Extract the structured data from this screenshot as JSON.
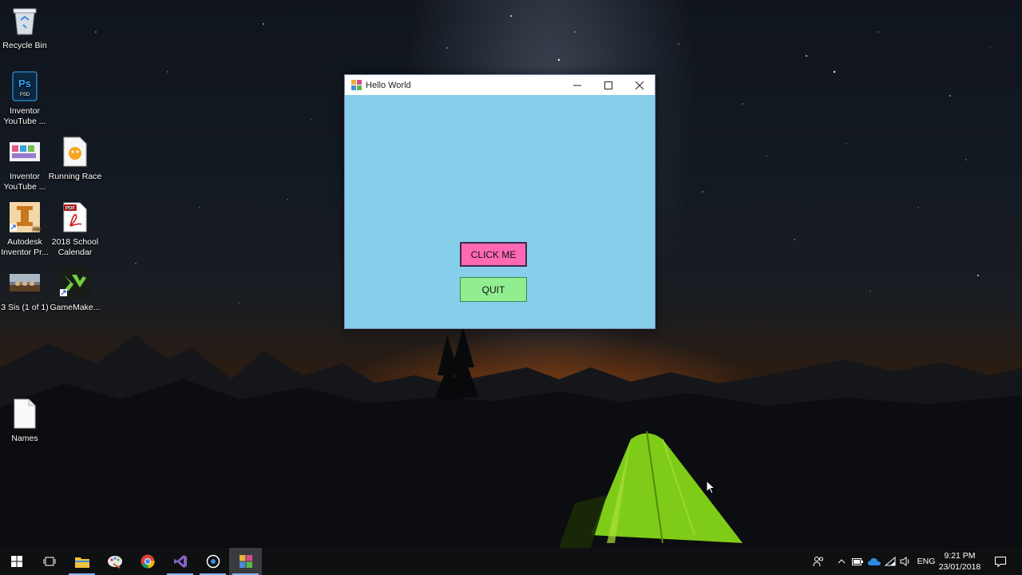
{
  "desktop": {
    "icons": [
      {
        "name": "recycle-bin",
        "label": "Recycle Bin",
        "icon": "recycle-bin-icon"
      },
      {
        "name": "psd-file",
        "label": "Inventor\nYouTube ...",
        "icon": "photoshop-icon"
      },
      {
        "name": "image-file",
        "label": "Inventor\nYouTube ...",
        "icon": "image-thumbnail-icon"
      },
      {
        "name": "scratch-file",
        "label": "Running Race",
        "icon": "scratch-cat-icon"
      },
      {
        "name": "autodesk-inventor",
        "label": "Autodesk\nInventor Pr...",
        "icon": "autodesk-inventor-icon"
      },
      {
        "name": "school-calendar",
        "label": "2018 School\nCalendar",
        "icon": "pdf-icon"
      },
      {
        "name": "photo-sis",
        "label": "3 Sis (1 of 1)",
        "icon": "photo-thumbnail-icon"
      },
      {
        "name": "gamemaker",
        "label": "GameMake...",
        "icon": "gamemaker-icon"
      },
      {
        "name": "names-file",
        "label": "Names",
        "icon": "text-file-icon"
      }
    ]
  },
  "window": {
    "title": "Hello World",
    "background_color": "#87ceeb",
    "buttons": {
      "click_me": {
        "label": "CLICK ME",
        "color": "#ff69b4"
      },
      "quit": {
        "label": "QUIT",
        "color": "#90ee90"
      }
    }
  },
  "taskbar": {
    "apps": [
      "start-icon",
      "task-view-icon",
      "file-explorer-icon",
      "paint-icon",
      "chrome-icon",
      "visual-studio-icon",
      "cortana-icon",
      "hello-world-app-icon"
    ],
    "language": "ENG",
    "time": "9:21 PM",
    "date": "23/01/2018"
  }
}
